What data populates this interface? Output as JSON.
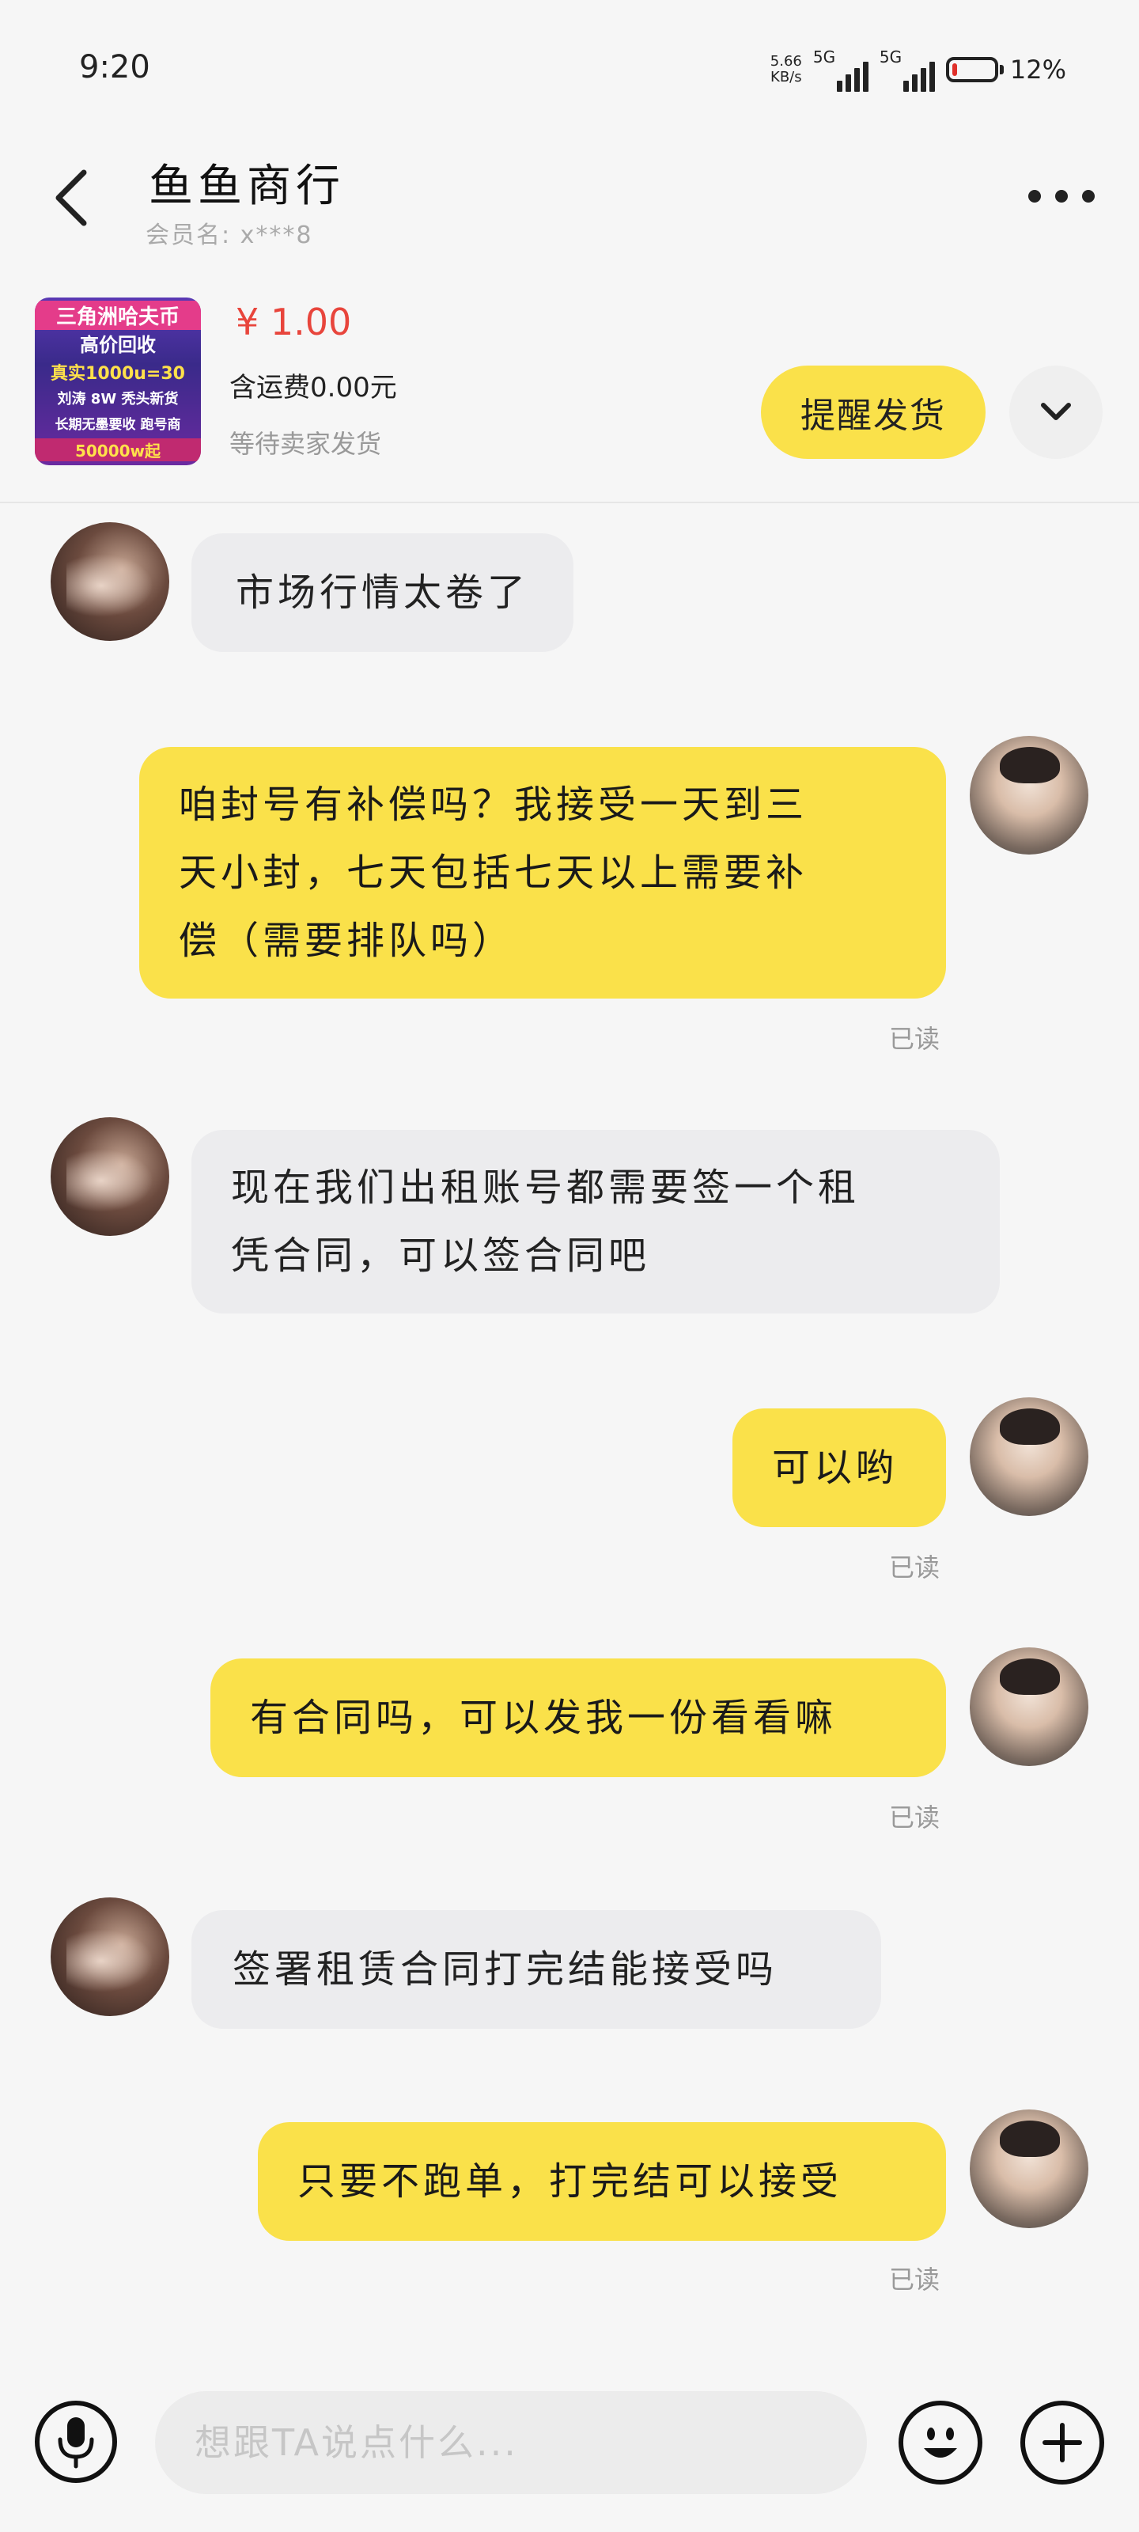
{
  "status_bar": {
    "time": "9:20",
    "net_speed_value": "5.66",
    "net_speed_unit": "KB/s",
    "sim1_tag": "5G",
    "sim2_tag": "5G",
    "battery_percent": "12%",
    "battery_level": 0.12,
    "battery_color": "#e0302a"
  },
  "header": {
    "title": "鱼鱼商行",
    "member_label": "会员名: x***8",
    "back_icon": "chevron-left-icon",
    "more_icon": "more-horizontal-icon"
  },
  "product": {
    "thumb_lines": [
      "三角洲哈夫币",
      "高价回收",
      "真实1000u=30",
      "刘涛 8W 秃头新货",
      "长期无墨要收 跑号商",
      "50000w起"
    ],
    "price": "¥ 1.00",
    "shipping": "含运费0.00元",
    "status": "等待卖家发货",
    "remind_button": "提醒发货",
    "expand_icon": "chevron-down-icon"
  },
  "messages": [
    {
      "from": "seller",
      "text": "市场行情太卷了",
      "read": ""
    },
    {
      "from": "me",
      "lines": [
        "咱封号有补偿吗？我接受一天到三",
        "天小封，七天包括七天以上需要补",
        "偿（需要排队吗）"
      ],
      "read": "已读"
    },
    {
      "from": "seller",
      "lines": [
        "现在我们出租账号都需要签一个租",
        "凭合同，可以签合同吧"
      ],
      "read": ""
    },
    {
      "from": "me",
      "text": "可以哟",
      "read": "已读"
    },
    {
      "from": "me",
      "text": "有合同吗，可以发我一份看看嘛",
      "read": "已读"
    },
    {
      "from": "seller",
      "text": "签署租赁合同打完结能接受吗",
      "read": ""
    },
    {
      "from": "me",
      "text": "只要不跑单，打完结可以接受",
      "read": "已读"
    }
  ],
  "input_bar": {
    "placeholder": "想跟TA说点什么...",
    "mic_icon": "microphone-icon",
    "emoji_icon": "emoji-icon",
    "plus_icon": "plus-icon"
  },
  "colors": {
    "accent_yellow": "#fae14a",
    "price_red": "#e8453c",
    "bubble_gray": "#ececee"
  }
}
